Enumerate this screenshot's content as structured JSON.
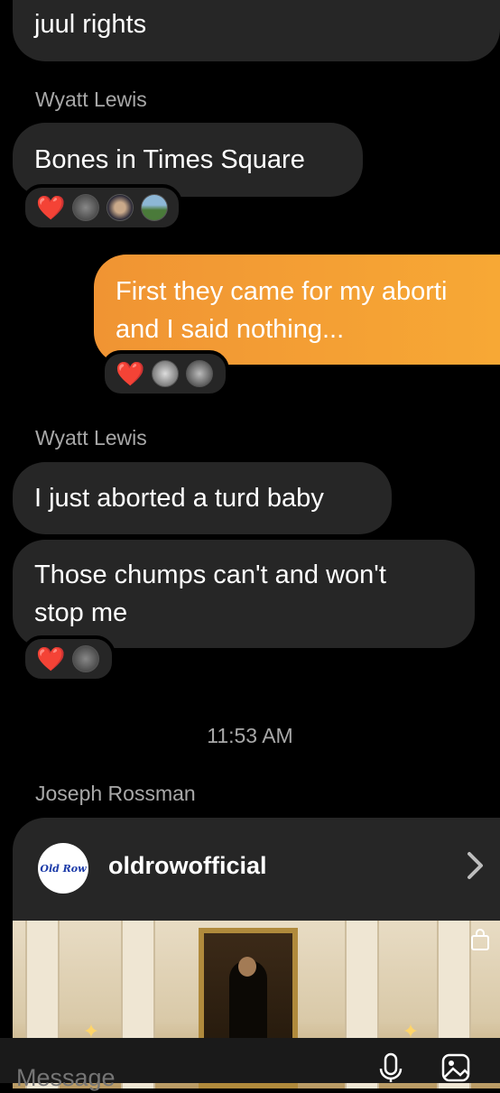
{
  "messages": {
    "m0_text": "juul rights",
    "sender1": "Wyatt Lewis",
    "m1_text": "Bones in Times Square",
    "m1_reaction": "❤️",
    "m2_line1": "First they came for my aborti",
    "m2_line2": "and I said nothing...",
    "m2_reaction": "❤️",
    "sender2": "Wyatt Lewis",
    "m3_text": "I just aborted a turd baby",
    "m4_line1": "Those chumps can't and won't",
    "m4_line2": "stop me",
    "m4_reaction": "❤️"
  },
  "timestamp": "11:53 AM",
  "sender3": "Joseph Rossman",
  "shared_post": {
    "logo_text": "Old Row",
    "username": "oldrowofficial",
    "chevron_icon": "chevron-right-icon",
    "shop_icon": "shopping-bag-icon"
  },
  "composer": {
    "placeholder": "Message",
    "mic_icon": "microphone-icon",
    "gallery_icon": "photo-gallery-icon"
  },
  "colors": {
    "background": "#000000",
    "bubble": "#262626",
    "outgoing_start": "#f09433",
    "outgoing_end": "#f7a835",
    "secondary_text": "#a8a8a8",
    "heart": "#ff2d3d"
  }
}
